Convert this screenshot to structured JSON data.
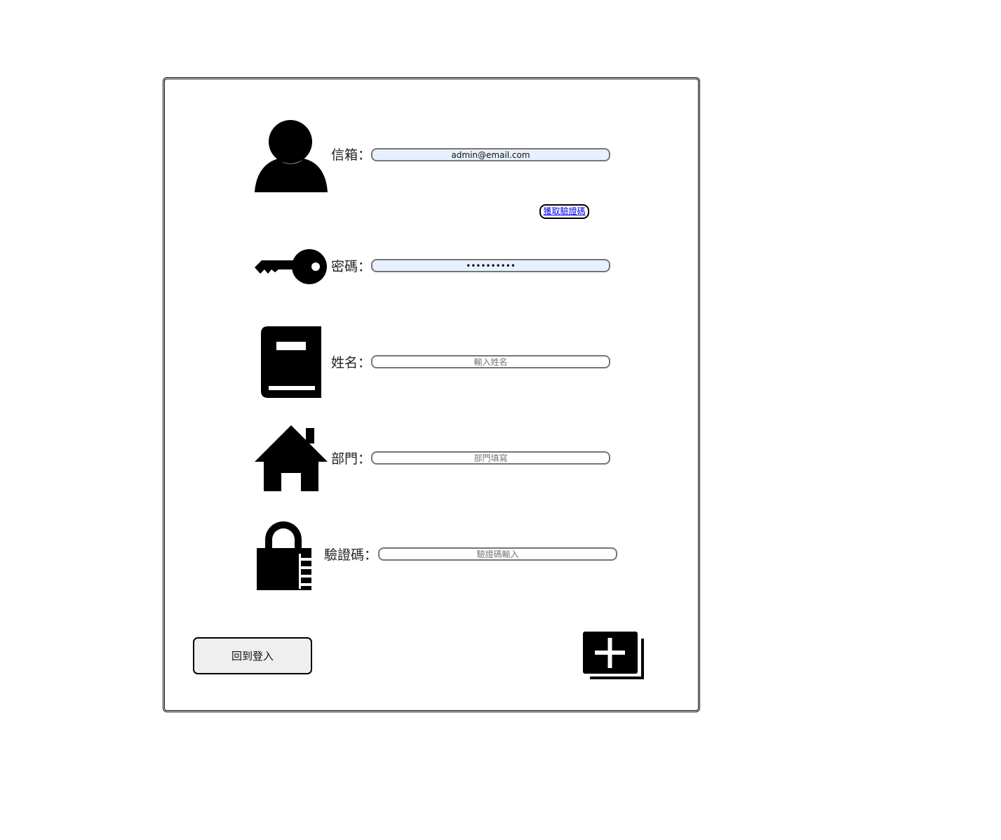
{
  "form": {
    "email": {
      "label": "信箱：",
      "value": "admin@email.com",
      "icon": "user-icon"
    },
    "get_code_button": "獲取驗證碼",
    "password": {
      "label": "密碼：",
      "value": "••••••••••",
      "icon": "key-icon"
    },
    "name": {
      "label": "姓名：",
      "placeholder": "輸入姓名",
      "icon": "book-icon"
    },
    "department": {
      "label": "部門：",
      "placeholder": "部門填寫",
      "icon": "home-icon"
    },
    "code": {
      "label": "驗證碼：",
      "placeholder": "驗證碼輸入",
      "icon": "lock-icon"
    }
  },
  "actions": {
    "back_label": "回到登入",
    "add_icon": "add-stack-icon"
  },
  "colors": {
    "autofill_bg": "#e8f0fe",
    "link": "#0000ee",
    "button_bg": "#efefef"
  }
}
